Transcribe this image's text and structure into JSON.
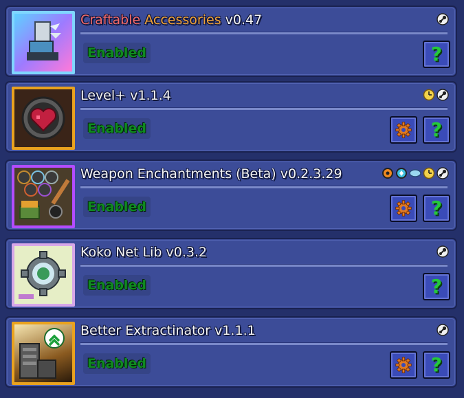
{
  "mods": [
    {
      "title_parts": [
        {
          "text": "Craftable ",
          "color": "#f26a6a"
        },
        {
          "text": "Accessories",
          "color": "#f0a33a"
        },
        {
          "text": " v0.47",
          "color": "#f4f4f4"
        }
      ],
      "status": "Enabled",
      "has_config": false,
      "tags": [
        "steam-icon"
      ],
      "thumb_border": "#7fd6ff"
    },
    {
      "title_parts": [
        {
          "text": "Level+ v1.1.4",
          "color": "#f4f4f4"
        }
      ],
      "status": "Enabled",
      "has_config": true,
      "tags": [
        "clock-icon",
        "steam-icon"
      ],
      "thumb_border": "#e9a21f"
    },
    {
      "title_parts": [
        {
          "text": "Weapon Enchantments (Beta) v0.2.3.29",
          "color": "#f4f4f4"
        }
      ],
      "status": "Enabled",
      "has_config": true,
      "tags": [
        "orange-badge-icon",
        "cyan-badge-icon",
        "blue-badge-icon",
        "clock-icon",
        "steam-icon"
      ],
      "thumb_border": "#b24cff"
    },
    {
      "title_parts": [
        {
          "text": "Koko Net Lib v0.3.2",
          "color": "#f4f4f4"
        }
      ],
      "status": "Enabled",
      "has_config": false,
      "tags": [
        "steam-icon"
      ],
      "thumb_border": "#d7a7e8"
    },
    {
      "title_parts": [
        {
          "text": "Better Extractinator v1.1.1",
          "color": "#f4f4f4"
        }
      ],
      "status": "Enabled",
      "has_config": true,
      "tags": [
        "steam-icon"
      ],
      "thumb_border": "#e9a21f"
    }
  ],
  "help_label": "?",
  "colors": {
    "panel": "#3c4c98",
    "background": "#24306a",
    "enabled_text": "#0f8a20",
    "help_green": "#24c93a",
    "config_orange": "#e07a22"
  }
}
